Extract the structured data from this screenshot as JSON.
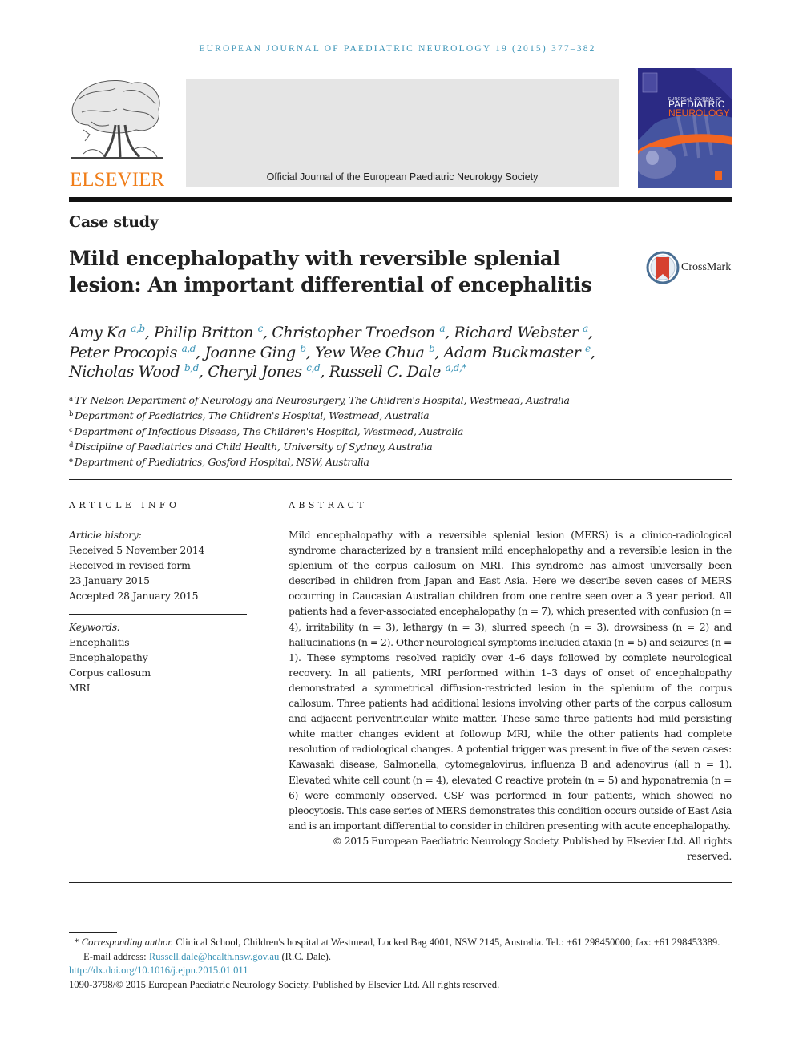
{
  "running_head": "European Journal of Paediatric Neurology 19 (2015) 377–382",
  "publisher": {
    "name": "ELSEVIER",
    "logo_icon": "elsevier-tree-icon",
    "brand_color": "#f07e1a"
  },
  "banner": {
    "text": "Official Journal of the European Paediatric Neurology Society"
  },
  "journal_cover": {
    "line1": "EUROPEAN JOURNAL OF",
    "line2": "PAEDIATRIC",
    "line3": "NEUROLOGY",
    "line4": "Official Journal of the European Paediatric Neurology Society"
  },
  "article": {
    "type": "Case study",
    "title_line1": "Mild encephalopathy with reversible splenial",
    "title_line2": "lesion: An important differential of encephalitis",
    "crossmark_label": "CrossMark",
    "authors": [
      {
        "name": "Amy Ka",
        "aff": "a,b"
      },
      {
        "name": "Philip Britton",
        "aff": "c"
      },
      {
        "name": "Christopher Troedson",
        "aff": "a"
      },
      {
        "name": "Richard Webster",
        "aff": "a"
      },
      {
        "name": "Peter Procopis",
        "aff": "a,d"
      },
      {
        "name": "Joanne Ging",
        "aff": "b"
      },
      {
        "name": "Yew Wee Chua",
        "aff": "b"
      },
      {
        "name": "Adam Buckmaster",
        "aff": "e"
      },
      {
        "name": "Nicholas Wood",
        "aff": "b,d"
      },
      {
        "name": "Cheryl Jones",
        "aff": "c,d"
      },
      {
        "name": "Russell C. Dale",
        "aff": "a,d,*"
      }
    ],
    "affiliations": [
      {
        "key": "a",
        "text": "TY Nelson Department of Neurology and Neurosurgery, The Children's Hospital, Westmead, Australia"
      },
      {
        "key": "b",
        "text": "Department of Paediatrics, The Children's Hospital, Westmead, Australia"
      },
      {
        "key": "c",
        "text": "Department of Infectious Disease, The Children's Hospital, Westmead, Australia"
      },
      {
        "key": "d",
        "text": "Discipline of Paediatrics and Child Health, University of Sydney, Australia"
      },
      {
        "key": "e",
        "text": "Department of Paediatrics, Gosford Hospital, NSW, Australia"
      }
    ]
  },
  "article_info": {
    "heading": "ARTICLE INFO",
    "history_label": "Article history:",
    "history": [
      "Received 5 November 2014",
      "Received in revised form",
      "23 January 2015",
      "Accepted 28 January 2015"
    ],
    "keywords_label": "Keywords:",
    "keywords": [
      "Encephalitis",
      "Encephalopathy",
      "Corpus callosum",
      "MRI"
    ]
  },
  "abstract": {
    "heading": "ABSTRACT",
    "text": "Mild encephalopathy with a reversible splenial lesion (MERS) is a clinico-radiological syndrome characterized by a transient mild encephalopathy and a reversible lesion in the splenium of the corpus callosum on MRI. This syndrome has almost universally been described in children from Japan and East Asia. Here we describe seven cases of MERS occurring in Caucasian Australian children from one centre seen over a 3 year period. All patients had a fever-associated encephalopathy (n = 7), which presented with confusion (n = 4), irritability (n = 3), lethargy (n = 3), slurred speech (n = 3), drowsiness (n = 2) and hallucinations (n = 2). Other neurological symptoms included ataxia (n = 5) and seizures (n = 1). These symptoms resolved rapidly over 4–6 days followed by complete neurological recovery. In all patients, MRI performed within 1–3 days of onset of encephalopathy demonstrated a symmetrical diffusion-restricted lesion in the splenium of the corpus callosum. Three patients had additional lesions involving other parts of the corpus callosum and adjacent periventricular white matter. These same three patients had mild persisting white matter changes evident at followup MRI, while the other patients had complete resolution of radiological changes. A potential trigger was present in five of the seven cases: Kawasaki disease, Salmonella, cytomegalovirus, influenza B and adenovirus (all n = 1). Elevated white cell count (n = 4), elevated C reactive protein (n = 5) and hyponatremia (n = 6) were commonly observed. CSF was performed in four patients, which showed no pleocytosis. This case series of MERS demonstrates this condition occurs outside of East Asia and is an important differential to consider in children presenting with acute encephalopathy.",
    "copyright": "© 2015 European Paediatric Neurology Society. Published by Elsevier Ltd. All rights reserved."
  },
  "footnotes": {
    "corresponding_marker": "*",
    "corresponding_label": "Corresponding author.",
    "corresponding_text": " Clinical School, Children's hospital at Westmead, Locked Bag 4001, NSW 2145, Australia. Tel.: +61 298450000; fax: +61 298453389.",
    "email_label": "E-mail address: ",
    "email": "Russell.dale@health.nsw.gov.au",
    "email_suffix": " (R.C. Dale).",
    "doi": "http://dx.doi.org/10.1016/j.ejpn.2015.01.011",
    "issn_line": "1090-3798/© 2015 European Paediatric Neurology Society. Published by Elsevier Ltd. All rights reserved."
  },
  "colors": {
    "link": "#3a93b6",
    "text": "#222222",
    "banner_bg": "#e5e5e5",
    "cover_bg": "#2b2a84",
    "cover_accent": "#f26522"
  }
}
